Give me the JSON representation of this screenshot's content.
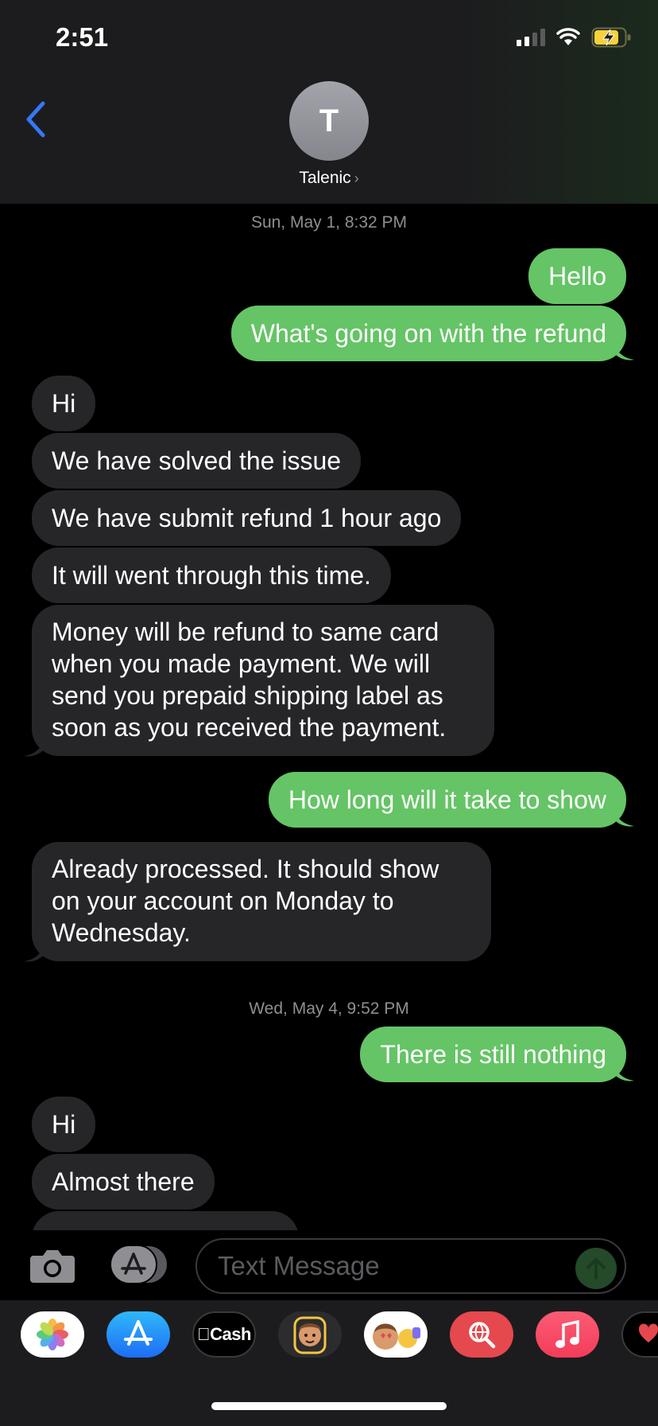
{
  "status_bar": {
    "time": "2:51"
  },
  "header": {
    "avatar_initial": "T",
    "contact_name": "Talenic"
  },
  "conversation": {
    "timestamps": [
      "Sun, May 1, 8:32 PM",
      "Wed, May 4, 9:52 PM"
    ],
    "messages": [
      {
        "dir": "out",
        "text": "Hello"
      },
      {
        "dir": "out",
        "text": "What's going on with the refund"
      },
      {
        "dir": "in",
        "text": "Hi"
      },
      {
        "dir": "in",
        "text": "We have solved the issue"
      },
      {
        "dir": "in",
        "text": "We have submit refund 1 hour ago"
      },
      {
        "dir": "in",
        "text": "It will went through this time."
      },
      {
        "dir": "in",
        "text": "Money will be refund to same card when you made payment. We will send you prepaid shipping label as soon as you received the payment."
      },
      {
        "dir": "out",
        "text": "How long will it take to show"
      },
      {
        "dir": "in",
        "text": "Already processed. It should show on your account on Monday to Wednesday."
      },
      {
        "dir": "out",
        "text": "There is still nothing"
      },
      {
        "dir": "in",
        "text": "Hi"
      },
      {
        "dir": "in",
        "text": "Almost there"
      }
    ]
  },
  "input_bar": {
    "placeholder": "Text Message"
  },
  "app_drawer": {
    "apps": [
      {
        "name": "Photos",
        "icon": "photos-icon"
      },
      {
        "name": "App Store",
        "icon": "app-store-icon"
      },
      {
        "name": "Cash",
        "icon": "apple-cash-icon",
        "label": "Cash"
      },
      {
        "name": "Memoji Stickers",
        "icon": "memoji-stickers-icon"
      },
      {
        "name": "Animoji",
        "icon": "animoji-icon"
      },
      {
        "name": "Web Search",
        "icon": "web-search-icon"
      },
      {
        "name": "Music",
        "icon": "music-icon"
      },
      {
        "name": "Digital Touch",
        "icon": "digital-touch-icon"
      }
    ]
  },
  "colors": {
    "outgoing_bubble": "#65c466",
    "incoming_bubble": "#262629",
    "accent_blue": "#3478f6"
  }
}
